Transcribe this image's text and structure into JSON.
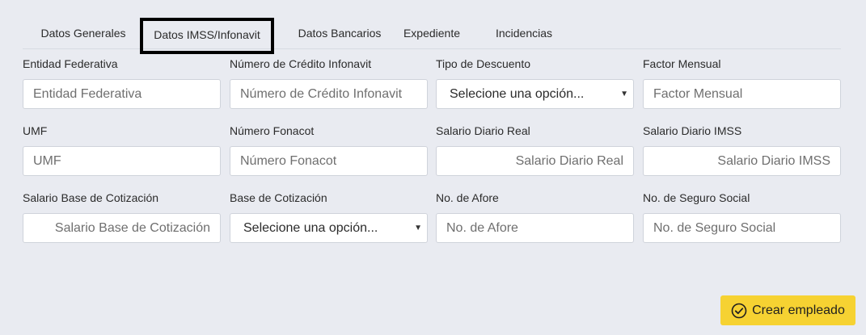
{
  "tabs": [
    {
      "label": "Datos Generales"
    },
    {
      "label": "Datos IMSS/Infonavit"
    },
    {
      "label": "Datos Bancarios"
    },
    {
      "label": "Expediente"
    },
    {
      "label": "Incidencias"
    }
  ],
  "form": {
    "entidad": {
      "label": "Entidad Federativa",
      "placeholder": "Entidad Federativa"
    },
    "credito": {
      "label": "Número de Crédito Infonavit",
      "placeholder": "Número de Crédito Infonavit"
    },
    "tipo_descuento": {
      "label": "Tipo de Descuento",
      "value": "Selecione una opción..."
    },
    "factor": {
      "label": "Factor Mensual",
      "placeholder": "Factor Mensual"
    },
    "umf": {
      "label": "UMF",
      "placeholder": "UMF"
    },
    "fonacot": {
      "label": "Número Fonacot",
      "placeholder": "Número Fonacot"
    },
    "salario_real": {
      "label": "Salario Diario Real",
      "placeholder": "Salario Diario Real"
    },
    "salario_imss": {
      "label": "Salario Diario IMSS",
      "placeholder": "Salario Diario IMSS"
    },
    "salario_base": {
      "label": "Salario Base de Cotización",
      "placeholder": "Salario Base de Cotización"
    },
    "base_cotizacion": {
      "label": "Base de Cotización",
      "value": "Selecione una opción..."
    },
    "afore": {
      "label": "No. de Afore",
      "placeholder": "No. de Afore"
    },
    "seguro_social": {
      "label": "No. de Seguro Social",
      "placeholder": "No. de Seguro Social"
    }
  },
  "actions": {
    "create_label": "Crear empleado"
  },
  "icons": {
    "create": "check-circle-icon",
    "select_caret": "caret-down-icon"
  },
  "colors": {
    "background": "#e9ebf1",
    "button": "#f6d232",
    "active_tab_border": "#000000"
  }
}
